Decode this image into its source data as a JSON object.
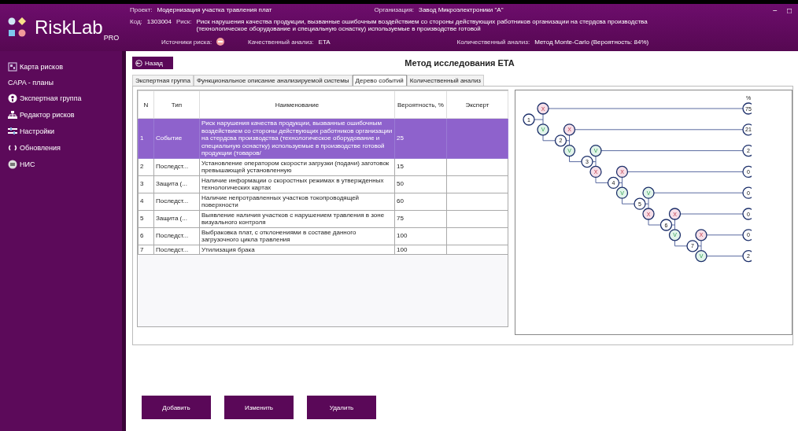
{
  "header": {
    "project_label": "Проект:",
    "project": "Модернизация участка травления плат",
    "org_label": "Организация:",
    "org": "Завод Микроэлектроники \"А\"",
    "code_label": "Код:",
    "code": "1303004",
    "risk_label": "Риск:",
    "risk": "Риск нарушения качества продукции, вызванные  ошибочным воздействием со стороны действующих работников организации на стердсва производства (технологическое оборудование и специальную оснастку) используемые в производстве готовой",
    "sources_label": "Источники риска:",
    "qual_label": "Качественный анализ:",
    "qual": "ETA",
    "quant_label": "Количественный анализ:",
    "quant": "Метод Monte-Carlo (Вероятность: 84%)"
  },
  "window_controls": [
    "−",
    "□"
  ],
  "logo": {
    "name": "RiskLab",
    "edition": "PRO"
  },
  "sidebar": {
    "items": [
      {
        "label": "Карта рисков"
      },
      {
        "label": "CAPA - планы"
      },
      {
        "label": "Экспертная группа"
      },
      {
        "label": "Редактор рисков"
      },
      {
        "label": "Настройки"
      },
      {
        "label": "Обновления"
      },
      {
        "label": "НИС"
      }
    ]
  },
  "back_button": "Назад",
  "title": "Метод исследования ETA",
  "tabs": [
    {
      "label": "Экспертная группа",
      "selected": false
    },
    {
      "label": "Функциональное описание анализируемой системы",
      "selected": false
    },
    {
      "label": "Дерево событий",
      "selected": true
    },
    {
      "label": "Количественный анализ",
      "selected": false
    }
  ],
  "table": {
    "columns": [
      "N",
      "Тип",
      "Наименование",
      "Вероятность, %",
      "Эксперт"
    ],
    "rows": [
      {
        "n": "1",
        "type": "Событие",
        "name": "Риск нарушения качества продукции, вызванные ошибочным воздействием со стороны действующих работников организации на стердсва производства (технологическое оборудование и специальную оснастку) используемые в производстве готовой продукции (товаров/",
        "probability": "25",
        "selected": true
      },
      {
        "n": "2",
        "type": "Последст...",
        "name": "Установление оператором скорости загрузки (подачи) заготовок превышающей установленную",
        "probability": "15",
        "selected": false
      },
      {
        "n": "3",
        "type": "Защита (...",
        "name": "Наличие информации о скоростных режимах в утвержденных технологических картах",
        "probability": "50",
        "selected": false
      },
      {
        "n": "4",
        "type": "Последст...",
        "name": "Наличие непротравленных участков токопроводящей поверхности",
        "probability": "60",
        "selected": false
      },
      {
        "n": "5",
        "type": "Защита (...",
        "name": "Выявление наличия участков с нарушением травления в зоне визуального контроля",
        "probability": "75",
        "selected": false
      },
      {
        "n": "6",
        "type": "Последст...",
        "name": "Выбраковка плат, с отклонениями в составе данного загрузочного цикла  травления",
        "probability": "100",
        "selected": false
      },
      {
        "n": "7",
        "type": "Последст...",
        "name": "Утилизация брака",
        "probability": "100",
        "selected": false
      }
    ]
  },
  "event_tree": {
    "header": "%",
    "steps": [
      {
        "label": "1",
        "upper": {
          "mark": "X",
          "kind": "fail"
        },
        "lower": {
          "mark": "V",
          "kind": "pass"
        }
      },
      {
        "label": "2",
        "upper": {
          "mark": "X",
          "kind": "fail"
        },
        "lower": {
          "mark": "V",
          "kind": "pass"
        }
      },
      {
        "label": "3",
        "upper": {
          "mark": "V",
          "kind": "pass"
        },
        "lower": {
          "mark": "X",
          "kind": "fail"
        }
      },
      {
        "label": "4",
        "upper": {
          "mark": "X",
          "kind": "fail"
        },
        "lower": {
          "mark": "V",
          "kind": "pass"
        }
      },
      {
        "label": "5",
        "upper": {
          "mark": "V",
          "kind": "pass"
        },
        "lower": {
          "mark": "X",
          "kind": "fail"
        }
      },
      {
        "label": "6",
        "upper": {
          "mark": "X",
          "kind": "fail"
        },
        "lower": {
          "mark": "V",
          "kind": "pass"
        }
      },
      {
        "label": "7",
        "upper": {
          "mark": "X",
          "kind": "fail"
        },
        "lower": {
          "mark": "V",
          "kind": "pass"
        }
      }
    ],
    "outcomes": [
      "75",
      "21",
      "2",
      "0",
      "0",
      "0",
      "0",
      "2"
    ]
  },
  "buttons": [
    "Добавить",
    "Изменить",
    "Удалить"
  ]
}
